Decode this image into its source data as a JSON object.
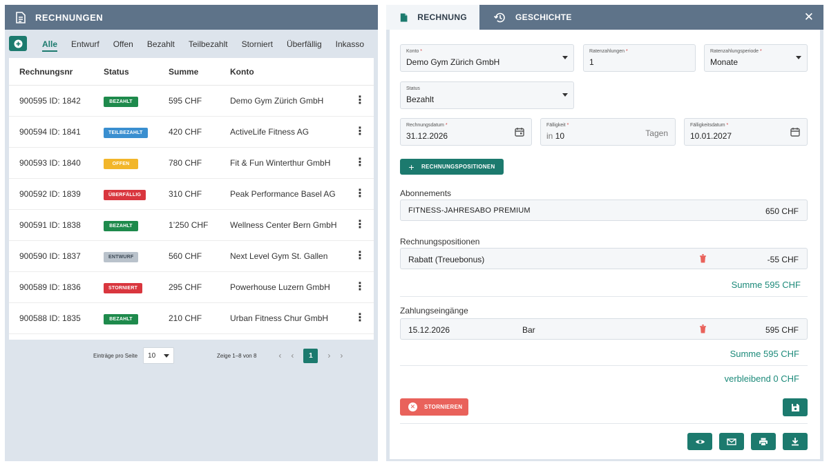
{
  "left": {
    "title": "RECHNUNGEN",
    "filters": [
      "Alle",
      "Entwurf",
      "Offen",
      "Bezahlt",
      "Teilbezahlt",
      "Storniert",
      "Überfällig",
      "Inkasso"
    ],
    "columns": [
      "Rechnungsnr",
      "Status",
      "Summe",
      "Konto"
    ],
    "rows": [
      {
        "nr": "900595  ID: 1842",
        "status": "BEZAHLT",
        "color": "#1e8a4c",
        "sum": "595 CHF",
        "account": "Demo Gym Zürich GmbH"
      },
      {
        "nr": "900594  ID: 1841",
        "status": "TEILBEZAHLT",
        "color": "#3a8fd0",
        "sum": "420 CHF",
        "account": "ActiveLife Fitness AG"
      },
      {
        "nr": "900593  ID: 1840",
        "status": "OFFEN",
        "color": "#f2b62a",
        "sum": "780 CHF",
        "account": "Fit & Fun Winterthur GmbH"
      },
      {
        "nr": "900592  ID: 1839",
        "status": "ÜBERFÄLLIG",
        "color": "#d9363e",
        "sum": "310 CHF",
        "account": "Peak Performance Basel AG"
      },
      {
        "nr": "900591  ID: 1838",
        "status": "BEZAHLT",
        "color": "#1e8a4c",
        "sum": "1’250 CHF",
        "account": "Wellness Center Bern GmbH"
      },
      {
        "nr": "900590  ID: 1837",
        "status": "ENTWURF",
        "color": "#b9c2cb",
        "sum": "560 CHF",
        "account": "Next Level Gym St. Gallen"
      },
      {
        "nr": "900589  ID: 1836",
        "status": "STORNIERT",
        "color": "#d9363e",
        "sum": "295 CHF",
        "account": "Powerhouse Luzern GmbH"
      },
      {
        "nr": "900588  ID: 1835",
        "status": "BEZAHLT",
        "color": "#1e8a4c",
        "sum": "210 CHF",
        "account": "Urban Fitness Chur GmbH"
      }
    ],
    "pager": {
      "per_page_label": "Einträge pro Seite",
      "per_page": "10",
      "range": "Zeige 1–8 von 8",
      "page": "1"
    }
  },
  "right": {
    "tabs": {
      "invoice": "RECHNUNG",
      "history": "GESCHICHTE"
    },
    "konto": {
      "label": "Konto",
      "value": "Demo Gym Zürich GmbH"
    },
    "raten": {
      "label": "Ratenzahlungen",
      "value": "1"
    },
    "periode": {
      "label": "Ratenzahlungsperiode",
      "value": "Monate"
    },
    "status": {
      "label": "Status",
      "value": "Bezahlt"
    },
    "rdatum": {
      "label": "Rechnungsdatum",
      "value": "31.12.2026"
    },
    "faellig": {
      "label": "Fälligkeit",
      "prefix": "in",
      "value": "10",
      "suffix": "Tagen"
    },
    "fdatum": {
      "label": "Fälligkeitsdatum",
      "value": "10.01.2027"
    },
    "add_positions": "RECHNUNGSPOSITIONEN",
    "abonnements": {
      "title": "Abonnements",
      "name": "FITNESS-JAHRESABO PREMIUM",
      "amount": "650 CHF"
    },
    "positionen": {
      "title": "Rechnungspositionen",
      "name": "Rabatt (Treuebonus)",
      "amount": "-55 CHF",
      "sum": "Summe 595 CHF"
    },
    "zahlungen": {
      "title": "Zahlungseingänge",
      "date": "15.12.2026",
      "method": "Bar",
      "amount": "595 CHF",
      "sum": "Summe 595 CHF"
    },
    "remaining": "verbleibend 0 CHF",
    "cancel": "STORNIEREN"
  }
}
